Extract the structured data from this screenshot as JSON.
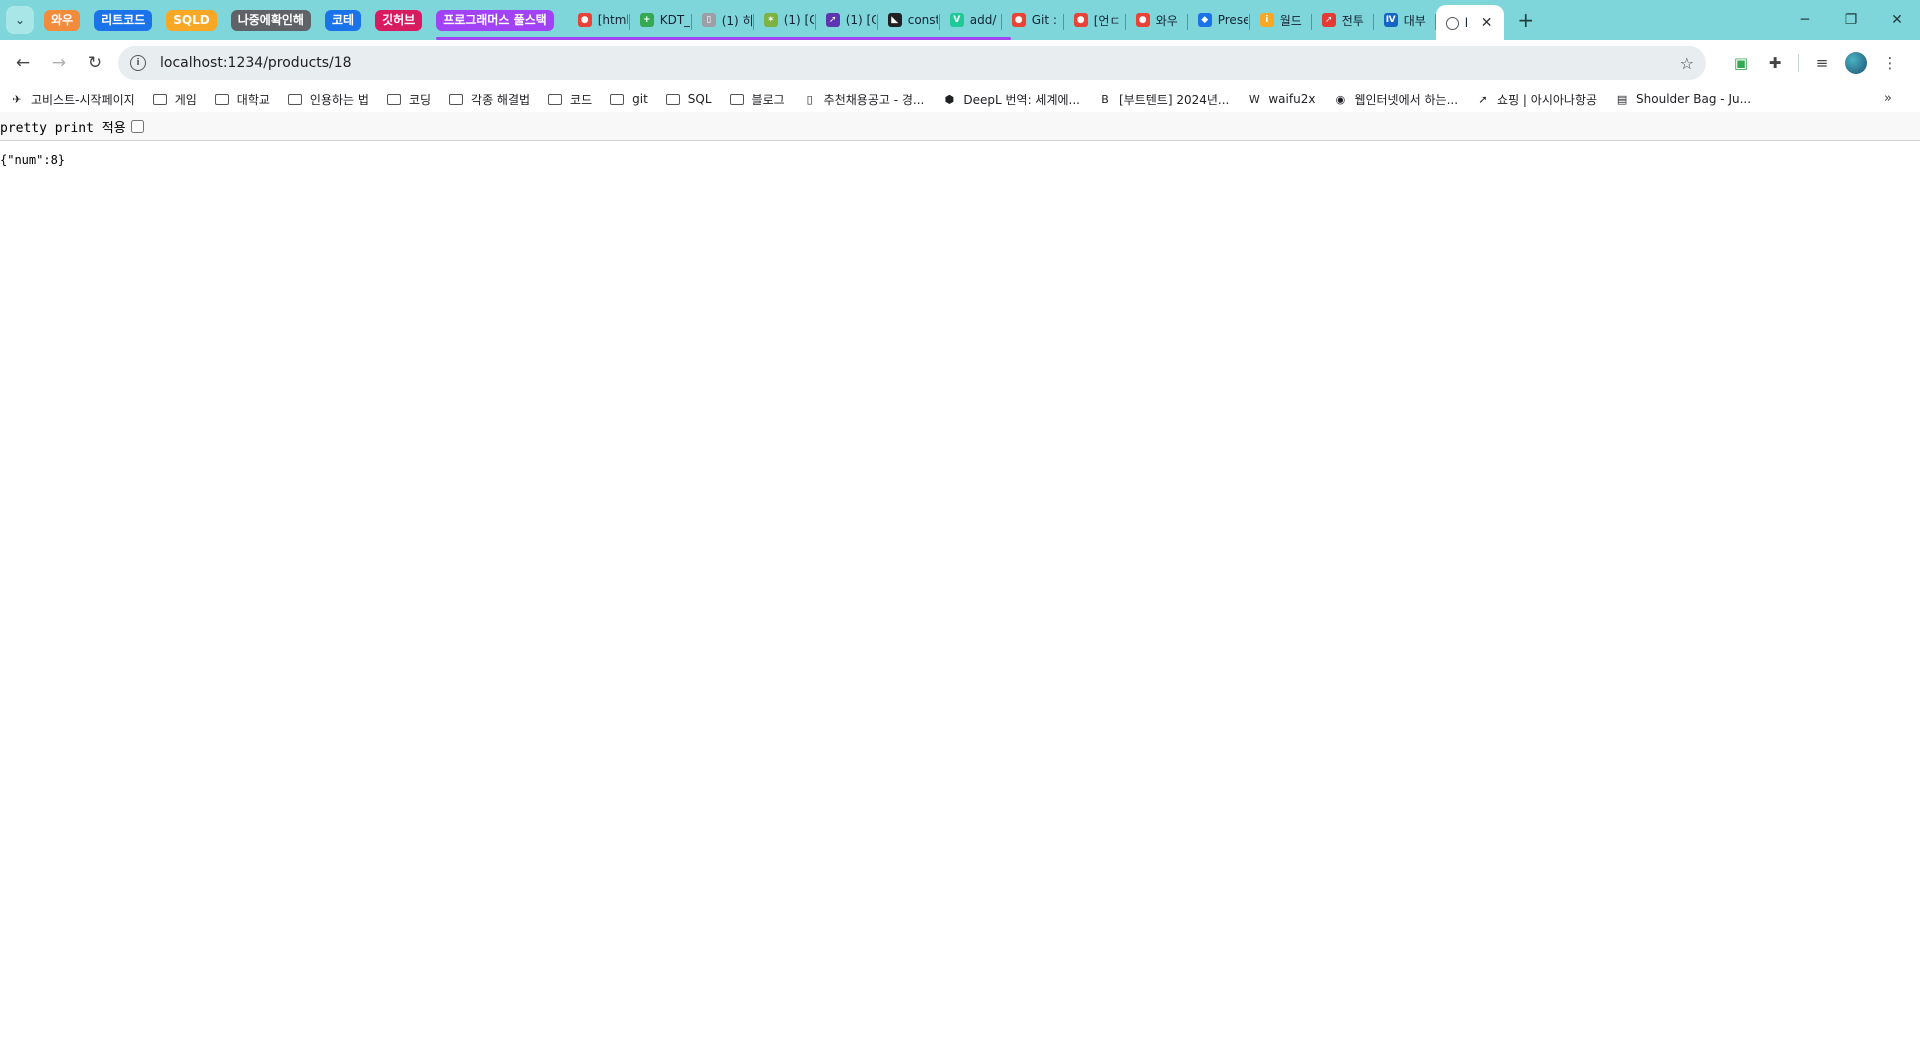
{
  "browser": {
    "tab_groups": [
      {
        "label": "와우",
        "color": "#f28b3b"
      },
      {
        "label": "리트코드",
        "color": "#1a73e8"
      },
      {
        "label": "SQLD",
        "color": "#f9a825"
      },
      {
        "label": "나중에확인해",
        "color": "#5f6368"
      },
      {
        "label": "코테",
        "color": "#1a73e8"
      },
      {
        "label": "깃허브",
        "color": "#d81b60"
      },
      {
        "label": "프로그래머스 풀스택",
        "color": "#a142f4"
      }
    ],
    "tabs": [
      {
        "title": "[html",
        "fav": "●",
        "fav_color": "#ea4335"
      },
      {
        "title": "KDT_",
        "fav": "+",
        "fav_color": "#34a853"
      },
      {
        "title": "(1) 히",
        "fav": "▯",
        "fav_color": "#9aa0a6"
      },
      {
        "title": "(1) [C",
        "fav": "✶",
        "fav_color": "#7cb342"
      },
      {
        "title": "(1) [C",
        "fav": "➚",
        "fav_color": "#5e35b1"
      },
      {
        "title": "const",
        "fav": "◣",
        "fav_color": "#202124"
      },
      {
        "title": "add/",
        "fav": "V",
        "fav_color": "#20c997"
      },
      {
        "title": "Git :",
        "fav": "●",
        "fav_color": "#ea4335"
      },
      {
        "title": "[언ㄷ",
        "fav": "●",
        "fav_color": "#ea4335"
      },
      {
        "title": "와우",
        "fav": "●",
        "fav_color": "#ea4335"
      },
      {
        "title": "Prese",
        "fav": "◆",
        "fav_color": "#1a73e8"
      },
      {
        "title": "월드",
        "fav": "i",
        "fav_color": "#f9a825"
      },
      {
        "title": "전투",
        "fav": "➚",
        "fav_color": "#e53935"
      },
      {
        "title": "대부",
        "fav": "Ⅳ",
        "fav_color": "#1565c0"
      }
    ],
    "current_tab": {
      "title": "l",
      "close": "✕"
    },
    "new_tab": "+",
    "window_controls": {
      "minimize": "─",
      "restore": "❐",
      "close": "✕"
    },
    "address_bar": {
      "url": "localhost:1234/products/18"
    },
    "bookmarks": [
      {
        "label": "고비스트-시작페이지",
        "icon": "✈",
        "type": "link"
      },
      {
        "label": "게임",
        "type": "folder"
      },
      {
        "label": "대학교",
        "type": "folder"
      },
      {
        "label": "인용하는 법",
        "type": "folder"
      },
      {
        "label": "코딩",
        "type": "folder"
      },
      {
        "label": "각종 해결법",
        "type": "folder"
      },
      {
        "label": "코드",
        "type": "folder"
      },
      {
        "label": "git",
        "type": "folder"
      },
      {
        "label": "SQL",
        "type": "folder"
      },
      {
        "label": "블로그",
        "type": "folder"
      },
      {
        "label": "추천채용공고 - 경...",
        "icon": "▯",
        "type": "link"
      },
      {
        "label": "DeepL 번역: 세계에...",
        "icon": "⬢",
        "type": "link"
      },
      {
        "label": "[부트텐트] 2024년...",
        "icon": "B",
        "type": "link"
      },
      {
        "label": "waifu2x",
        "icon": "W",
        "type": "link"
      },
      {
        "label": "웹인터넷에서 하는...",
        "icon": "◉",
        "type": "link"
      },
      {
        "label": "쇼핑 | 아시아나항공",
        "icon": "➚",
        "type": "link"
      },
      {
        "label": "Shoulder Bag - Ju...",
        "icon": "▤",
        "type": "link"
      }
    ],
    "bookmarks_more": "»"
  },
  "page": {
    "pretty_print_label": "pretty print 적용",
    "pretty_print_checked": false,
    "json_body": "{\"num\":8}"
  }
}
